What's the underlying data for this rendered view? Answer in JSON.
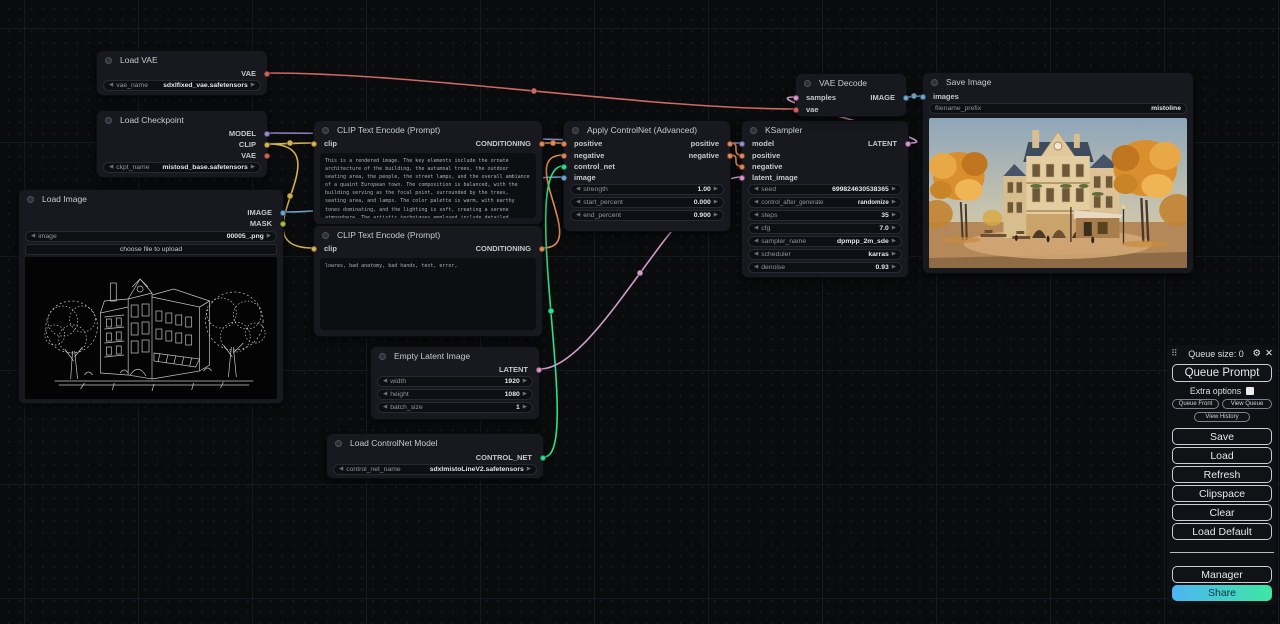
{
  "icons": {
    "gear": "⚙",
    "close": "✕",
    "drag": "⠿",
    "dec": "◀",
    "inc": "▶"
  },
  "colors": {
    "vae": "#d5655c",
    "model": "#9a8fd0",
    "clip": "#d9b64e",
    "conditioning": "#e0895a",
    "image": "#6da8d8",
    "mask": "#a9c24c",
    "latent": "#e292ce",
    "control_net": "#2fd98a",
    "share_gradient_start": "#4cb5f5",
    "share_gradient_end": "#3ee6a3"
  },
  "nodes": {
    "load_vae": {
      "title": "Load VAE",
      "outputs": [
        {
          "label": "VAE"
        }
      ],
      "widgets": [
        {
          "name": "vae_name",
          "value": "sdxlfixed_vae.safetensors"
        }
      ]
    },
    "load_checkpoint": {
      "title": "Load Checkpoint",
      "outputs": [
        {
          "label": "MODEL"
        },
        {
          "label": "CLIP"
        },
        {
          "label": "VAE"
        }
      ],
      "widgets": [
        {
          "name": "ckpt_name",
          "value": "mistosd_base.safetensors"
        }
      ]
    },
    "load_image": {
      "title": "Load Image",
      "outputs": [
        {
          "label": "IMAGE"
        },
        {
          "label": "MASK"
        }
      ],
      "widgets": [
        {
          "name": "image",
          "value": "00005_.png"
        }
      ],
      "button": "choose file to upload"
    },
    "clip_positive": {
      "title": "CLIP Text Encode (Prompt)",
      "inputs": [
        {
          "label": "clip"
        }
      ],
      "outputs": [
        {
          "label": "CONDITIONING"
        }
      ],
      "text": "This is a rendered image. The key elements include the ornate architecture of the building, the autumnal trees, the outdoor seating area, the people, the street lamps, and the overall ambiance of a quaint European town. The composition is balanced, with the building serving as the focal point, surrounded by the trees, seating area, and lamps. The color palette is warm, with earthy tones dominating, and the lighting is soft, creating a serene atmosphere. The artistic techniques employed include detailed rendering, realistic textures, and a blend of natural and artificial lighting."
    },
    "clip_negative": {
      "title": "CLIP Text Encode (Prompt)",
      "inputs": [
        {
          "label": "clip"
        }
      ],
      "outputs": [
        {
          "label": "CONDITIONING"
        }
      ],
      "text": "lowres, bad anatomy, bad hands, text, error,"
    },
    "apply_controlnet": {
      "title": "Apply ControlNet (Advanced)",
      "inputs": [
        {
          "label": "positive"
        },
        {
          "label": "negative"
        },
        {
          "label": "control_net"
        },
        {
          "label": "image"
        }
      ],
      "outputs": [
        {
          "label": "positive"
        },
        {
          "label": "negative"
        }
      ],
      "widgets": [
        {
          "name": "strength",
          "value": "1.00"
        },
        {
          "name": "start_percent",
          "value": "0.000"
        },
        {
          "name": "end_percent",
          "value": "0.900"
        }
      ]
    },
    "ksampler": {
      "title": "KSampler",
      "inputs": [
        {
          "label": "model"
        },
        {
          "label": "positive"
        },
        {
          "label": "negative"
        },
        {
          "label": "latent_image"
        }
      ],
      "outputs": [
        {
          "label": "LATENT"
        }
      ],
      "widgets": [
        {
          "name": "seed",
          "value": "699824630538365"
        },
        {
          "name": "control_after_generate",
          "value": "randomize"
        },
        {
          "name": "steps",
          "value": "35"
        },
        {
          "name": "cfg",
          "value": "7.0"
        },
        {
          "name": "sampler_name",
          "value": "dpmpp_2m_sde"
        },
        {
          "name": "scheduler",
          "value": "karras"
        },
        {
          "name": "denoise",
          "value": "0.93"
        }
      ]
    },
    "vae_decode": {
      "title": "VAE Decode",
      "inputs": [
        {
          "label": "samples"
        },
        {
          "label": "vae"
        }
      ],
      "outputs": [
        {
          "label": "IMAGE"
        }
      ]
    },
    "save_image": {
      "title": "Save Image",
      "inputs": [
        {
          "label": "images"
        }
      ],
      "widgets": [
        {
          "name": "filename_prefix",
          "value": "mistoline"
        }
      ]
    },
    "empty_latent": {
      "title": "Empty Latent Image",
      "outputs": [
        {
          "label": "LATENT"
        }
      ],
      "widgets": [
        {
          "name": "width",
          "value": "1920"
        },
        {
          "name": "height",
          "value": "1080"
        },
        {
          "name": "batch_size",
          "value": "1"
        }
      ]
    },
    "load_controlnet": {
      "title": "Load ControlNet Model",
      "outputs": [
        {
          "label": "CONTROL_NET"
        }
      ],
      "widgets": [
        {
          "name": "control_net_name",
          "value": "sdxlmistoLineV2.safetensors"
        }
      ]
    }
  },
  "menu": {
    "queue_size": "Queue size: 0",
    "queue_prompt": "Queue Prompt",
    "extra_options": "Extra options",
    "queue_front": "Queue Front",
    "view_queue": "View Queue",
    "view_history": "View History",
    "save": "Save",
    "load": "Load",
    "refresh": "Refresh",
    "clipspace": "Clipspace",
    "clear": "Clear",
    "load_default": "Load Default",
    "manager": "Manager",
    "share": "Share"
  }
}
